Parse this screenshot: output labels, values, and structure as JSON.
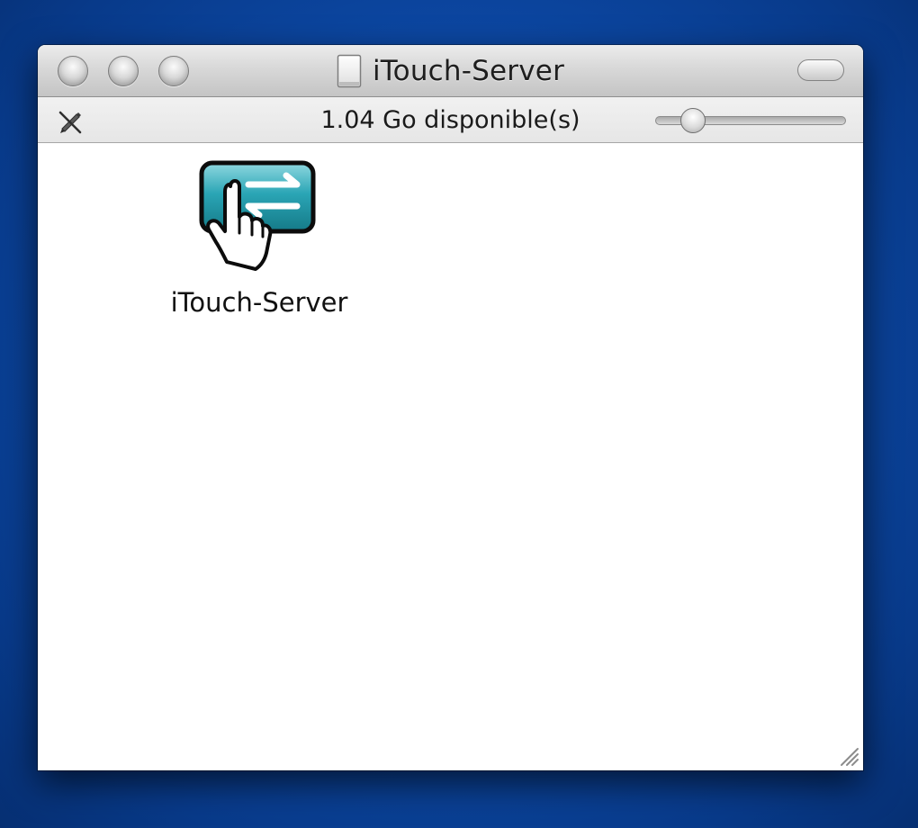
{
  "window": {
    "title": "iTouch-Server",
    "title_icon": "document-icon",
    "traffic_lights": [
      "close-button",
      "minimize-button",
      "zoom-button"
    ]
  },
  "statusbar": {
    "space_available": "1.04 Go disponible(s)",
    "edit_icon": "pencil-crossed-icon",
    "icon_size_slider_level": 0.2
  },
  "files": [
    {
      "label": "iTouch-Server",
      "icon": "hand-arrows-app-icon",
      "icon_color": "#2aa5b5"
    }
  ]
}
